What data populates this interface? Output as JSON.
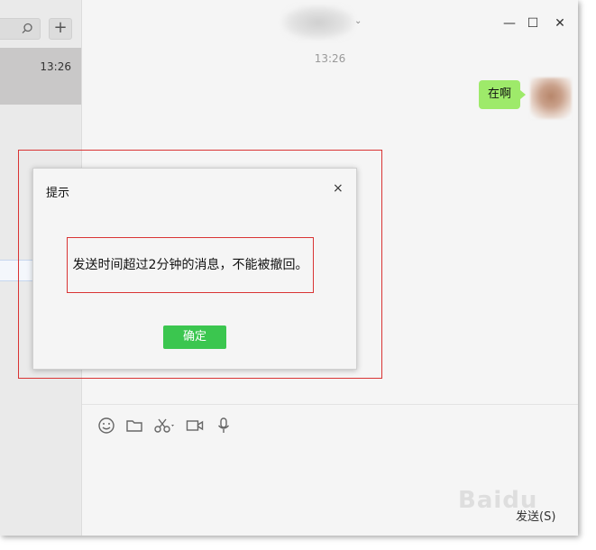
{
  "left_pane": {
    "search_icon": "search-icon",
    "add_icon": "plus-icon",
    "add_label": "+",
    "chat_item": {
      "time": "13:26"
    }
  },
  "header": {
    "arrow": "⌄",
    "window_controls": {
      "minimize": "—",
      "maximize": "☐",
      "close": "✕"
    }
  },
  "conversation": {
    "timestamp": "13:26",
    "messages": [
      {
        "from": "me",
        "text": "在啊",
        "bubble_color": "#9eea6a"
      }
    ]
  },
  "toolbar": {
    "icons": [
      "emoji-icon",
      "folder-icon",
      "scissors-icon",
      "video-icon",
      "microphone-icon"
    ]
  },
  "composer": {
    "send_label": "发送(S)"
  },
  "dialog": {
    "title": "提示",
    "close_label": "×",
    "message": "发送时间超过2分钟的消息，不能被撤回。",
    "confirm_label": "确定",
    "confirm_color": "#3bc64f",
    "highlight_color": "#d93434"
  },
  "watermark": "Baidu"
}
